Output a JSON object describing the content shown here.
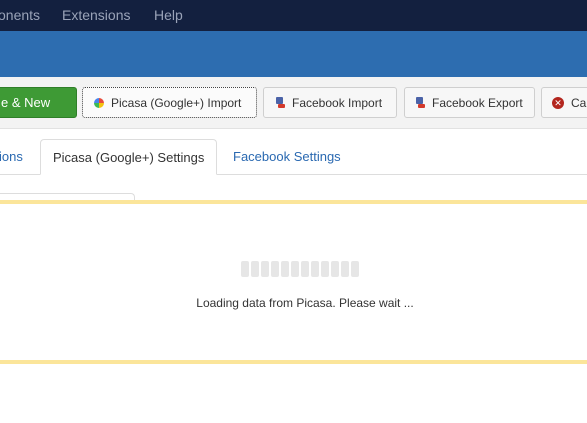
{
  "topnav": {
    "items": [
      "onents",
      "Extensions",
      "Help"
    ]
  },
  "toolbar": {
    "buttons": [
      {
        "label": "e & New",
        "icon": "save-new-icon",
        "style": "green"
      },
      {
        "label": "Picasa (Google+) Import",
        "icon": "picasa-icon"
      },
      {
        "label": "Facebook Import",
        "icon": "facebook-import-icon"
      },
      {
        "label": "Facebook Export",
        "icon": "facebook-export-icon"
      },
      {
        "label": "Ca",
        "icon": "cancel-icon"
      }
    ]
  },
  "tabs": {
    "items": [
      {
        "label": "ions"
      },
      {
        "label": "Picasa (Google+) Settings",
        "active": true
      },
      {
        "label": "Facebook Settings"
      }
    ]
  },
  "loading": {
    "message": "Loading data from Picasa. Please wait ...",
    "bar_count": 12
  },
  "colors": {
    "topnav_bg": "#13203f",
    "header_bg": "#2d6db0",
    "green_button": "#3e9a35",
    "link_blue": "#2a69b1",
    "panel_border_yellow": "#fbe59a"
  }
}
